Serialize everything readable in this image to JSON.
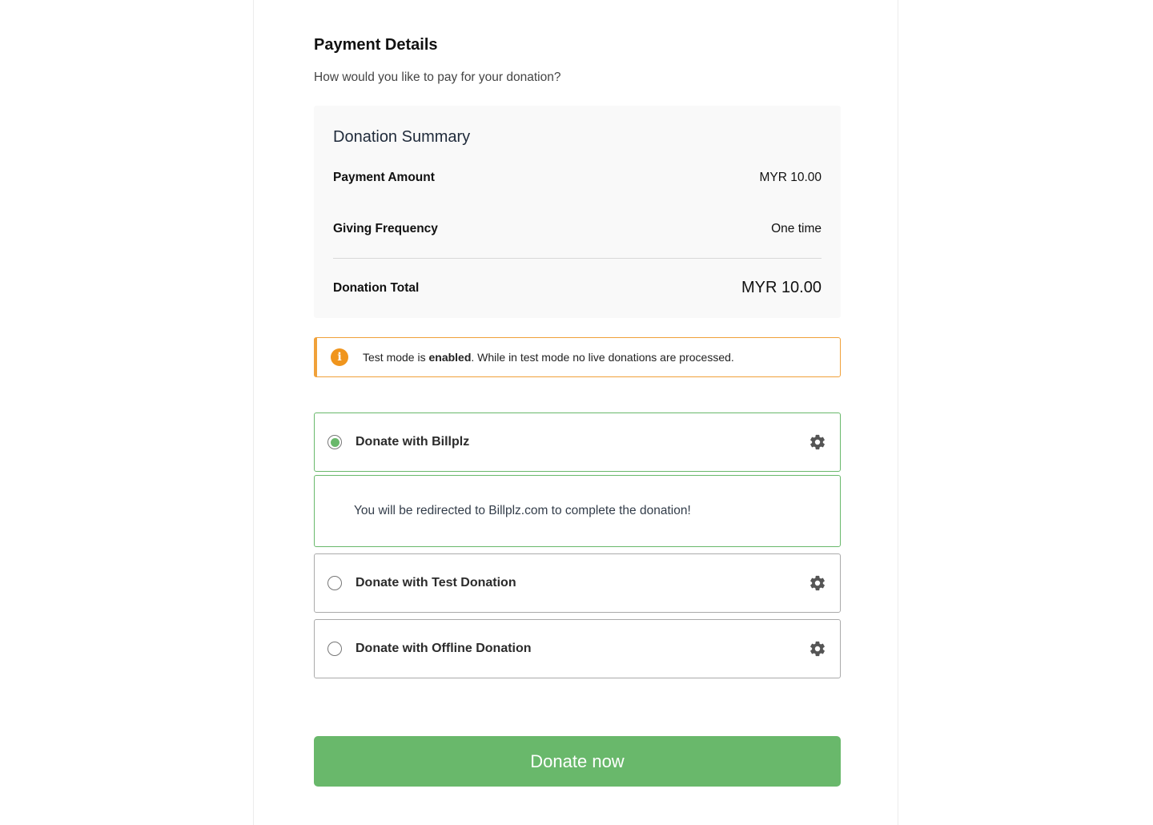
{
  "header": {
    "title": "Payment Details",
    "subtitle": "How would you like to pay for your donation?"
  },
  "summary": {
    "heading": "Donation Summary",
    "payment_amount_label": "Payment Amount",
    "payment_amount_value": "MYR 10.00",
    "frequency_label": "Giving Frequency",
    "frequency_value": "One time",
    "total_label": "Donation Total",
    "total_value": "MYR 10.00"
  },
  "notice": {
    "icon": "info-icon",
    "text_before": "Test mode is ",
    "text_bold": "enabled",
    "text_after": ". While in test mode no live donations are processed.",
    "color": "#f0a13a"
  },
  "gateways": [
    {
      "label": "Donate with Billplz",
      "selected": true,
      "details": "You will be redirected to Billplz.com to complete the donation!"
    },
    {
      "label": "Donate with Test Donation",
      "selected": false
    },
    {
      "label": "Donate with Offline Donation",
      "selected": false
    }
  ],
  "submit": {
    "label": "Donate now",
    "color": "#69b86b"
  }
}
